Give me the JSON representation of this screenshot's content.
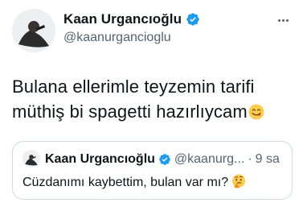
{
  "tweet": {
    "author": {
      "display_name": "Kaan Urgancıoğlu",
      "handle": "@kaanurgancioglu",
      "verified": true
    },
    "text": "Bulana ellerimle teyzemin tarifi müthiş bi spagetti hazırlıycam",
    "text_emoji": "yum-face-icon"
  },
  "quoted_tweet": {
    "author": {
      "display_name": "Kaan Urgancıoğlu",
      "handle": "@kaanurg...",
      "verified": true
    },
    "separator": "·",
    "time": "9 sa",
    "text": "Cüzdanımı kaybettim, bulan var mı?",
    "text_emoji": "thinking-face-icon"
  },
  "colors": {
    "verified_blue": "#1d9bf0",
    "text_primary": "#0f1419",
    "text_secondary": "#536471",
    "border": "#cfd9de"
  }
}
